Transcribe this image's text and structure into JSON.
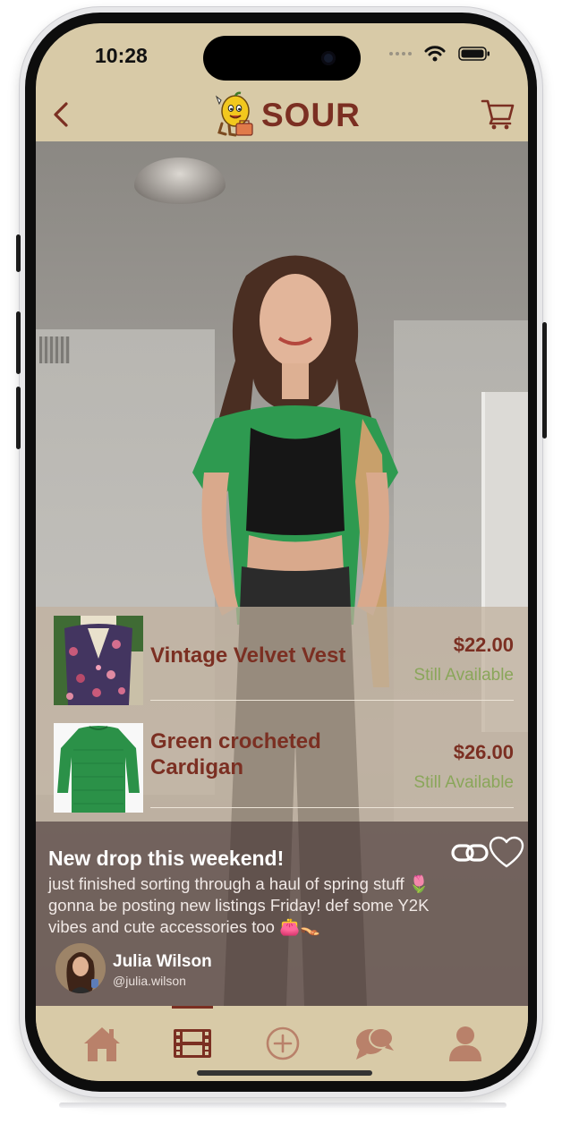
{
  "status_bar": {
    "time": "10:28",
    "wifi_icon": "wifi-icon",
    "battery_icon": "battery-icon"
  },
  "header": {
    "back_icon": "chevron-left-icon",
    "logo_text": "SOUR",
    "logo_mascot": "lemon-mascot-icon",
    "cart_icon": "cart-icon"
  },
  "products": [
    {
      "name": "Vintage Velvet Vest",
      "price": "$22.00",
      "status": "Still Available",
      "thumb": "floral-vest-photo"
    },
    {
      "name": "Green crocheted Cardigan",
      "price": "$26.00",
      "status": "Still Available",
      "thumb": "green-cardigan-photo"
    }
  ],
  "post": {
    "title": "New drop this weekend!",
    "body": "just finished sorting through a haul of spring stuff 🌷 gonna be posting new listings Friday! def some Y2K vibes and cute accessories too 👛👡",
    "author_name": "Julia Wilson",
    "author_handle": "@julia.wilson"
  },
  "tabs": [
    {
      "name": "home",
      "icon": "home-icon"
    },
    {
      "name": "feed",
      "icon": "film-icon",
      "active": true
    },
    {
      "name": "sell",
      "icon": "plus-circle-icon"
    },
    {
      "name": "messages",
      "icon": "chat-bubbles-icon"
    },
    {
      "name": "profile",
      "icon": "person-icon"
    }
  ],
  "colors": {
    "brand_cream": "#d8caa7",
    "brand_maroon": "#7b2f22",
    "available_green": "#8aa65a",
    "tab_icon": "#b9816a"
  }
}
